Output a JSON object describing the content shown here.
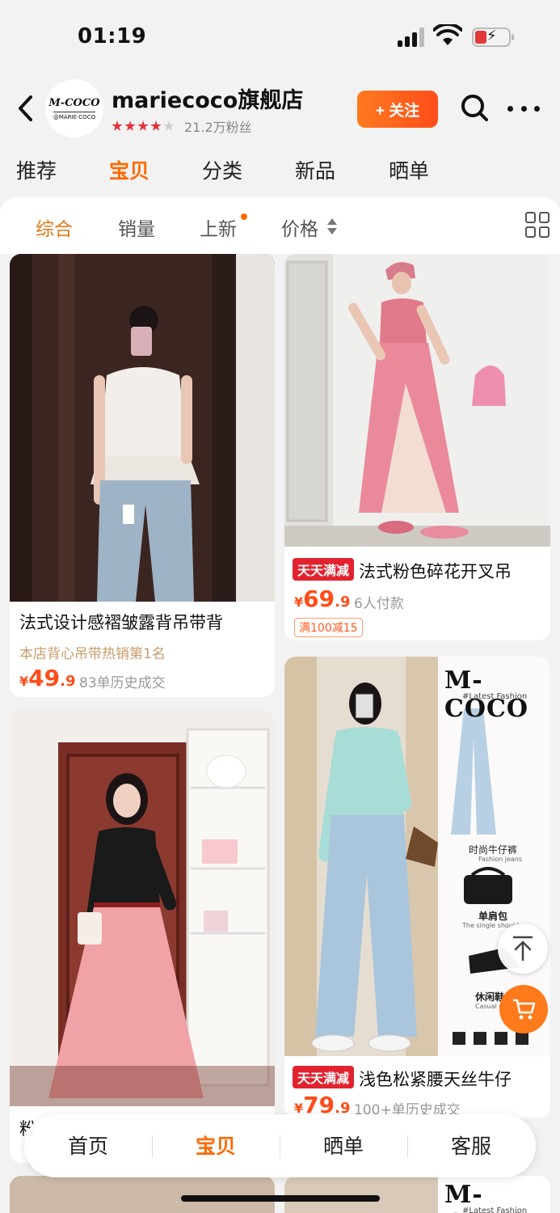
{
  "status": {
    "time": "01:19"
  },
  "store": {
    "logo_text": "M-COCO",
    "logo_sub": "@MARIE·COCO",
    "name": "mariecoco旗舰店",
    "stars": 4,
    "fans": "21.2万粉丝",
    "follow_label": "+ 关注"
  },
  "tabs": [
    "推荐",
    "宝贝",
    "分类",
    "新品",
    "晒单"
  ],
  "active_tab": "宝贝",
  "sort": {
    "items": [
      "综合",
      "销量",
      "上新",
      "价格"
    ],
    "active": "综合"
  },
  "products": [
    {
      "title": "法式设计感褶皱露背吊带背",
      "subtitle": "本店背心吊带热销第1名",
      "price_currency": "¥",
      "price_int": "49",
      "price_dec": ".9",
      "sold": "83单历史成交"
    },
    {
      "promo": "天天满减",
      "title": "法式粉色碎花开叉吊",
      "price_currency": "¥",
      "price_int": "69",
      "price_dec": ".9",
      "sold": "6人付款",
      "coupon": "满100减15"
    },
    {
      "title": "粉"
    },
    {
      "brand": "M-COCO",
      "brand_sub": "#Latest Fashion",
      "callouts": [
        "时尚牛仔裤",
        "Fashion jeans",
        "单肩包",
        "The single shoulder",
        "休闲鞋",
        "Casual s"
      ],
      "promo": "天天满减",
      "title": "浅色松紧腰天丝牛仔",
      "price_currency": "¥",
      "price_int": "79",
      "price_dec": ".9",
      "sold": "100+单历史成交"
    },
    {
      "brand": "M-COCO",
      "brand_sub": "#Latest Fashion"
    }
  ],
  "bottom_nav": [
    "首页",
    "宝贝",
    "晒单",
    "客服"
  ],
  "bottom_active": "宝贝",
  "colors": {
    "accent": "#ff6a00",
    "price": "#ff4d1a",
    "promo": "#e2232f"
  }
}
